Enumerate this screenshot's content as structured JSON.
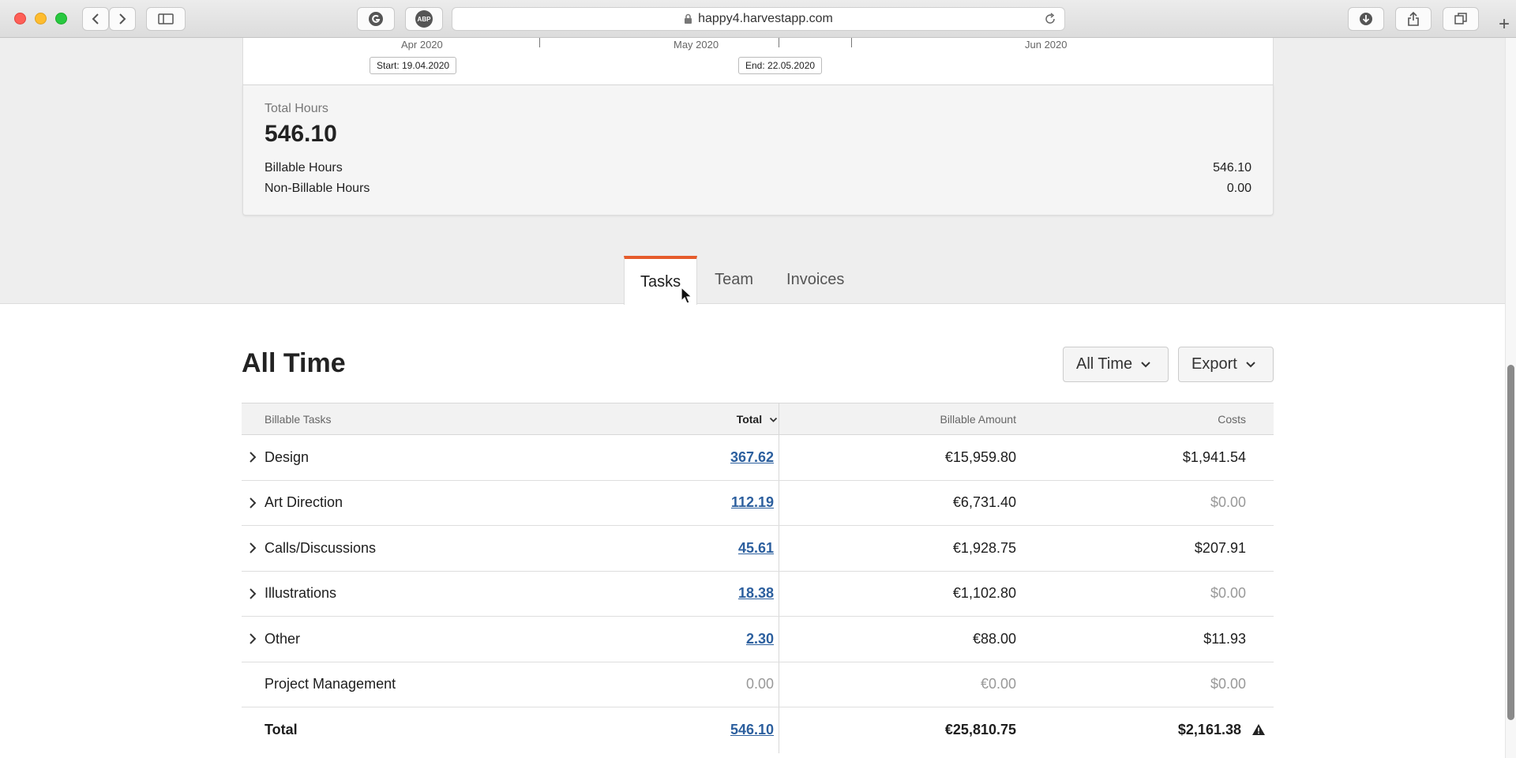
{
  "browser": {
    "url": "happy4.harvestapp.com",
    "extension_abp_label": "ABP",
    "new_tab_label": "+"
  },
  "timeline": {
    "months": [
      "Apr 2020",
      "May 2020",
      "Jun 2020"
    ],
    "start_badge": "Start: 19.04.2020",
    "end_badge": "End: 22.05.2020"
  },
  "hours": {
    "label": "Total Hours",
    "total": "546.10",
    "billable_label": "Billable Hours",
    "billable_value": "546.10",
    "nonbillable_label": "Non-Billable Hours",
    "nonbillable_value": "0.00"
  },
  "tabs": [
    {
      "label": "Tasks",
      "active": true
    },
    {
      "label": "Team",
      "active": false
    },
    {
      "label": "Invoices",
      "active": false
    }
  ],
  "section": {
    "title": "All Time",
    "range_dropdown": "All Time",
    "export_dropdown": "Export"
  },
  "table": {
    "headers": {
      "name": "Billable Tasks",
      "total": "Total",
      "billable": "Billable Amount",
      "costs": "Costs"
    },
    "rows": [
      {
        "name": "Design",
        "total": "367.62",
        "billable": "€15,959.80",
        "costs": "$1,941.54"
      },
      {
        "name": "Art Direction",
        "total": "112.19",
        "billable": "€6,731.40",
        "costs": "$0.00"
      },
      {
        "name": "Calls/Discussions",
        "total": "45.61",
        "billable": "€1,928.75",
        "costs": "$207.91"
      },
      {
        "name": "Illustrations",
        "total": "18.38",
        "billable": "€1,102.80",
        "costs": "$0.00"
      },
      {
        "name": "Other",
        "total": "2.30",
        "billable": "€88.00",
        "costs": "$11.93"
      },
      {
        "name": "Project Management",
        "total": "0.00",
        "billable": "€0.00",
        "costs": "$0.00"
      }
    ],
    "footer": {
      "name": "Total",
      "total": "546.10",
      "billable": "€25,810.75",
      "costs": "$2,161.38"
    }
  },
  "colors": {
    "accent": "#e55b2c",
    "link": "#2c5f9e"
  }
}
